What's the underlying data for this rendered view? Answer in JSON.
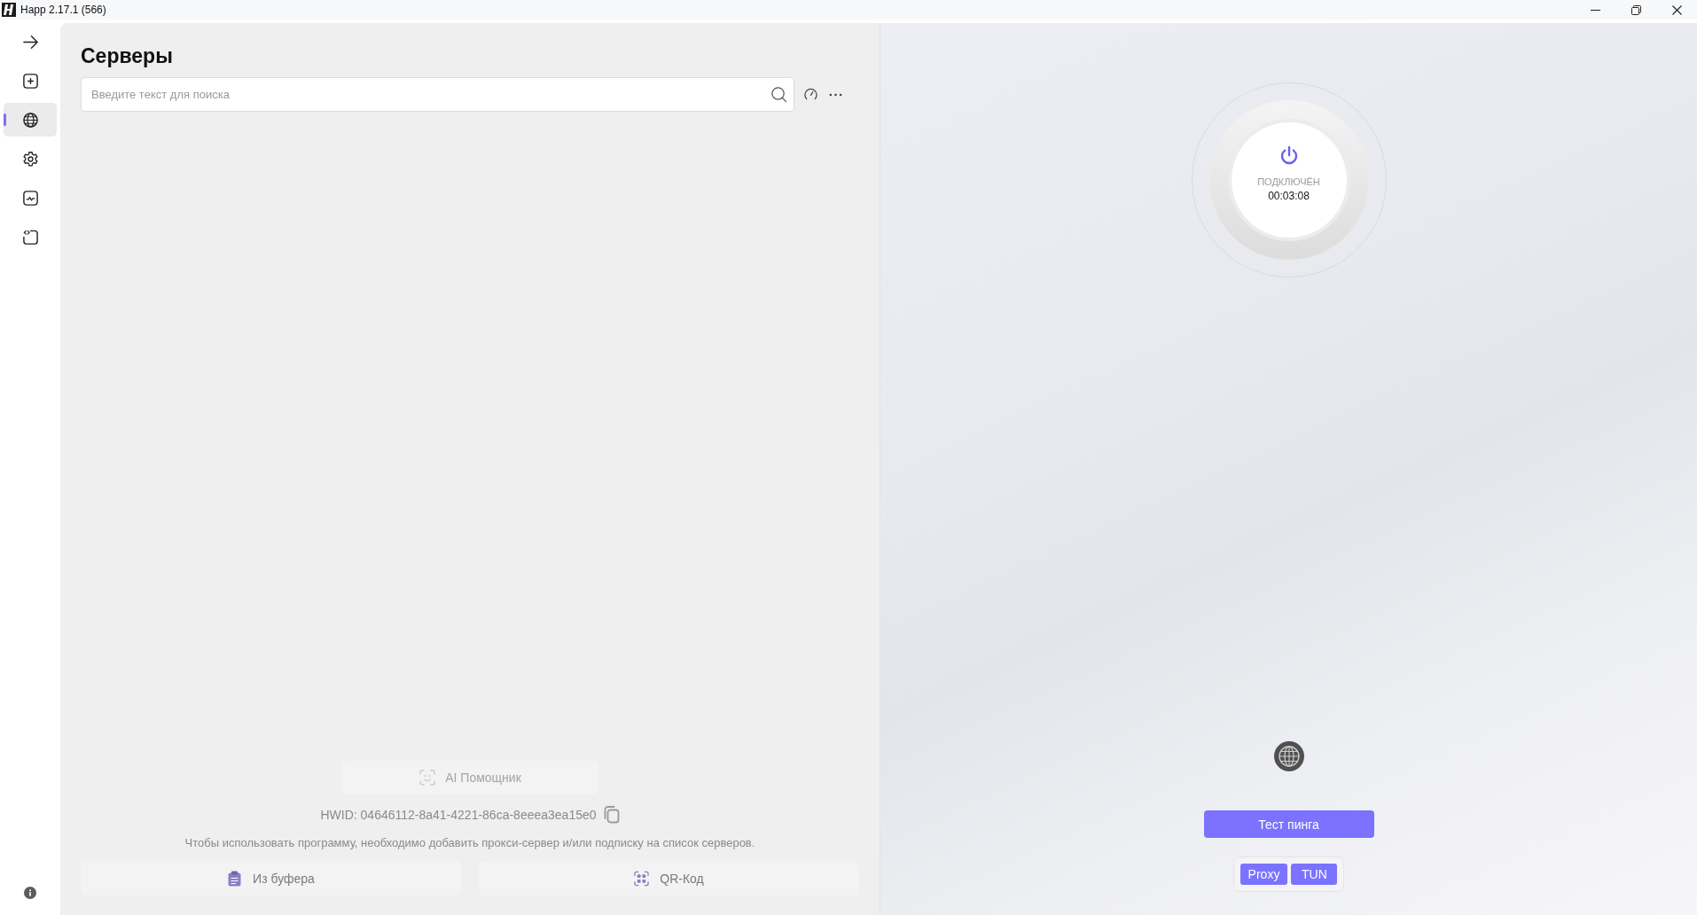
{
  "window": {
    "title": "Happ 2.17.1 (566)"
  },
  "sidebar": {
    "items": [
      {
        "kind": "arrow",
        "selected": false
      },
      {
        "kind": "add",
        "selected": false
      },
      {
        "kind": "globe",
        "selected": true
      },
      {
        "kind": "settings",
        "selected": false
      },
      {
        "kind": "monitor",
        "selected": false
      },
      {
        "kind": "code",
        "selected": false
      }
    ],
    "footer": {
      "kind": "info"
    }
  },
  "servers": {
    "title": "Серверы",
    "search": {
      "placeholder": "Введите текст для поиска"
    },
    "ai_button": {
      "label": "AI Помощник",
      "disabled": true
    },
    "hwid": "HWID: 04646112-8a41-4221-86ca-8eeea3ea15e0",
    "hint": "Чтобы использовать программу, необходимо добавить прокси-сервер и/или подписку на список серверов.",
    "actions": [
      {
        "kind": "clipboard",
        "label": "Из буфера"
      },
      {
        "kind": "qr",
        "label": "QR-Код"
      }
    ]
  },
  "connection": {
    "connected": true,
    "status": "ПОДКЛЮЧЁН",
    "timer": "00:03:08",
    "ping_button": "Тест пинга",
    "modes": [
      {
        "label": "Proxy",
        "selected": true
      },
      {
        "label": "TUN",
        "selected": true
      }
    ]
  }
}
